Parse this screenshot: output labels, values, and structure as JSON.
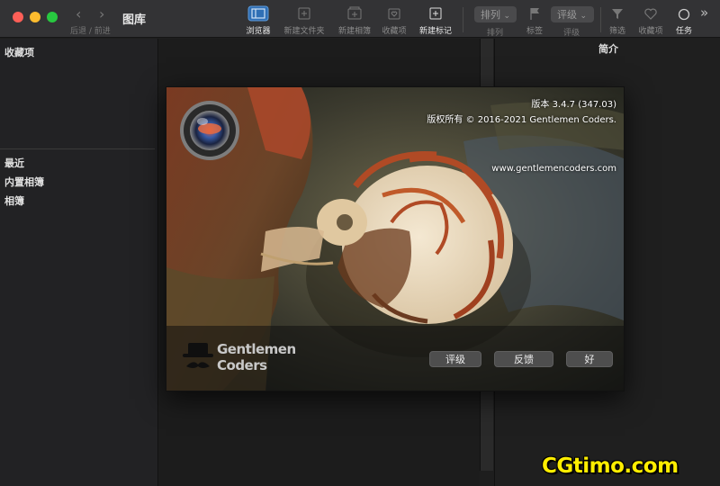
{
  "window": {
    "title": "图库",
    "nav_label": "后退 / 前进"
  },
  "toolbar": {
    "browser": "浏览器",
    "new_folder": "新建文件夹",
    "new_album": "新建相簿",
    "favorites": "收藏项",
    "new_tag": "新建标记",
    "sort_value": "排列",
    "sort_label": "排列",
    "tags_label": "标签",
    "rating_value": "评级",
    "rating_label": "评级",
    "filter_label": "筛选",
    "fav_label": "收藏项",
    "tasks_label": "任务"
  },
  "sidebar": {
    "favorites_header": "收藏项",
    "recent": "最近",
    "builtin_albums": "内置相簿",
    "albums": "相簿"
  },
  "right_panel": {
    "title": "简介"
  },
  "about": {
    "version": "版本 3.4.7 (347.03)",
    "copyright": "版权所有 © 2016-2021 Gentlemen Coders.",
    "website": "www.gentlemencoders.com",
    "logo_line1": "Gentlemen",
    "logo_line2": "Coders",
    "buttons": {
      "rate": "评级",
      "feedback": "反馈",
      "ok": "好"
    }
  },
  "watermark": "CGtimo.com",
  "colors": {
    "accent_toolbar_selected": "#3f7fc0",
    "watermark": "#ffee00"
  }
}
